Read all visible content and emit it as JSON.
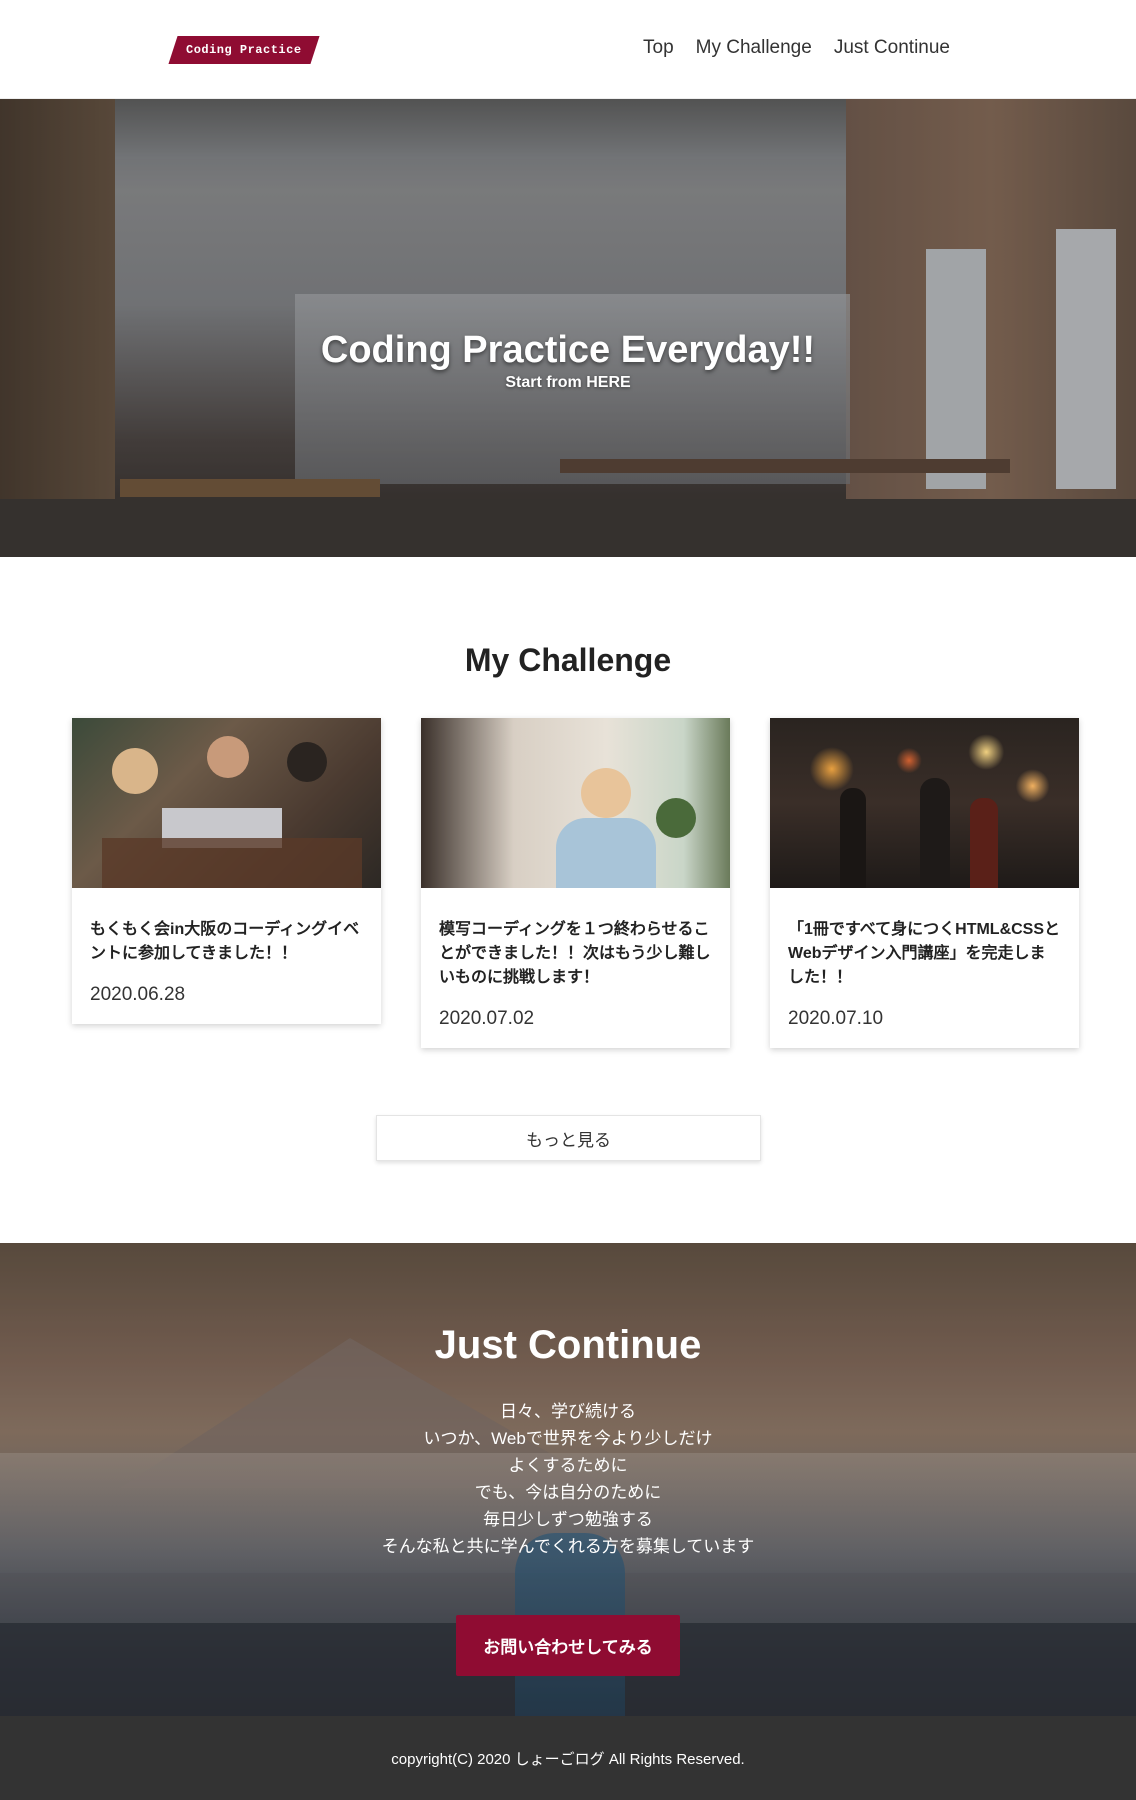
{
  "header": {
    "logo_text": "Coding Practice",
    "nav": [
      {
        "label": "Top"
      },
      {
        "label": "My Challenge"
      },
      {
        "label": "Just Continue"
      }
    ]
  },
  "hero": {
    "title": "Coding Practice Everyday!!",
    "subtitle": "Start from HERE"
  },
  "challenge": {
    "title": "My Challenge",
    "cards": [
      {
        "text": "もくもく会in大阪のコーディングイベントに参加してきました！！",
        "date": "2020.06.28"
      },
      {
        "text": "模写コーディングを１つ終わらせることができました！！次はもう少し難しいものに挑戦します！",
        "date": "2020.07.02"
      },
      {
        "text": "「1冊ですべて身につくHTML&CSSとWebデザイン入門講座」を完走しました！！",
        "date": "2020.07.10"
      }
    ],
    "more_label": "もっと見る"
  },
  "cont": {
    "title": "Just Continue",
    "lines": [
      "日々、学び続ける",
      "いつか、Webで世界を今より少しだけ",
      "よくするために",
      "でも、今は自分のために",
      "毎日少しずつ勉強する",
      "そんな私と共に学んでくれる方を募集しています"
    ],
    "button_label": "お問い合わせしてみる"
  },
  "footer": {
    "copyright": "copyright(C) 2020 しょーごログ All Rights Reserved."
  },
  "colors": {
    "accent": "#8f0c32",
    "footer_bg": "#333333"
  }
}
